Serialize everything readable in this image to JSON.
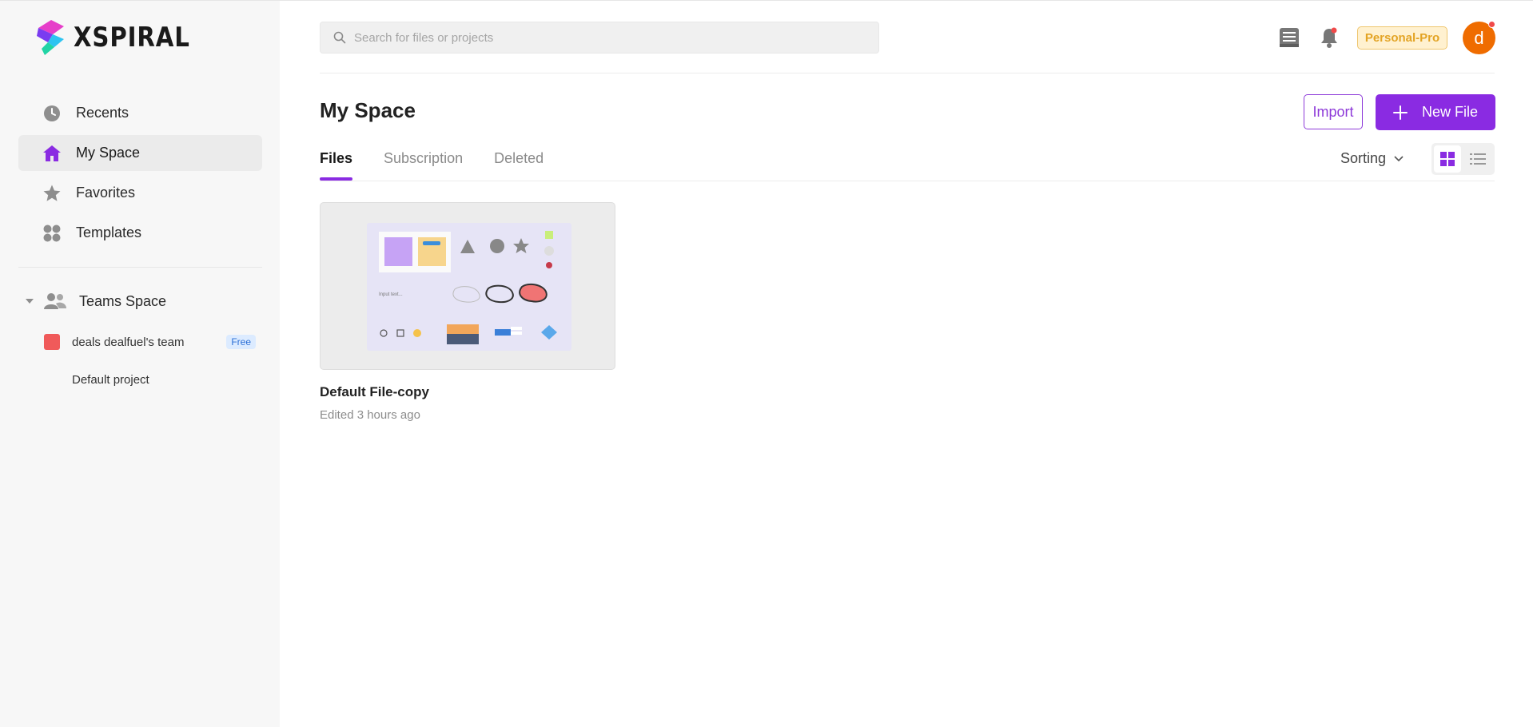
{
  "app": {
    "name": "XSPIRAL"
  },
  "sidebar": {
    "items": [
      {
        "label": "Recents",
        "icon": "clock-icon"
      },
      {
        "label": "My Space",
        "icon": "home-icon",
        "active": true
      },
      {
        "label": "Favorites",
        "icon": "star-icon"
      },
      {
        "label": "Templates",
        "icon": "templates-icon"
      }
    ],
    "teams_label": "Teams Space",
    "team": {
      "name": "deals dealfuel's team",
      "badge": "Free",
      "color": "#f05a5a"
    },
    "project": "Default project"
  },
  "header": {
    "search_placeholder": "Search for files or projects",
    "plan": "Personal-Pro",
    "avatar_initial": "d"
  },
  "main": {
    "title": "My Space",
    "import_label": "Import",
    "new_file_label": "New File",
    "tabs": [
      {
        "label": "Files",
        "active": true
      },
      {
        "label": "Subscription"
      },
      {
        "label": "Deleted"
      }
    ],
    "sorting_label": "Sorting",
    "files": [
      {
        "name": "Default File-copy",
        "edited": "Edited 3 hours ago",
        "thumb_text": "Input text..."
      }
    ]
  },
  "colors": {
    "accent": "#8a2be2",
    "plan_badge": "#e3a425",
    "avatar": "#ef6c00",
    "team_swatch": "#f05a5a"
  }
}
